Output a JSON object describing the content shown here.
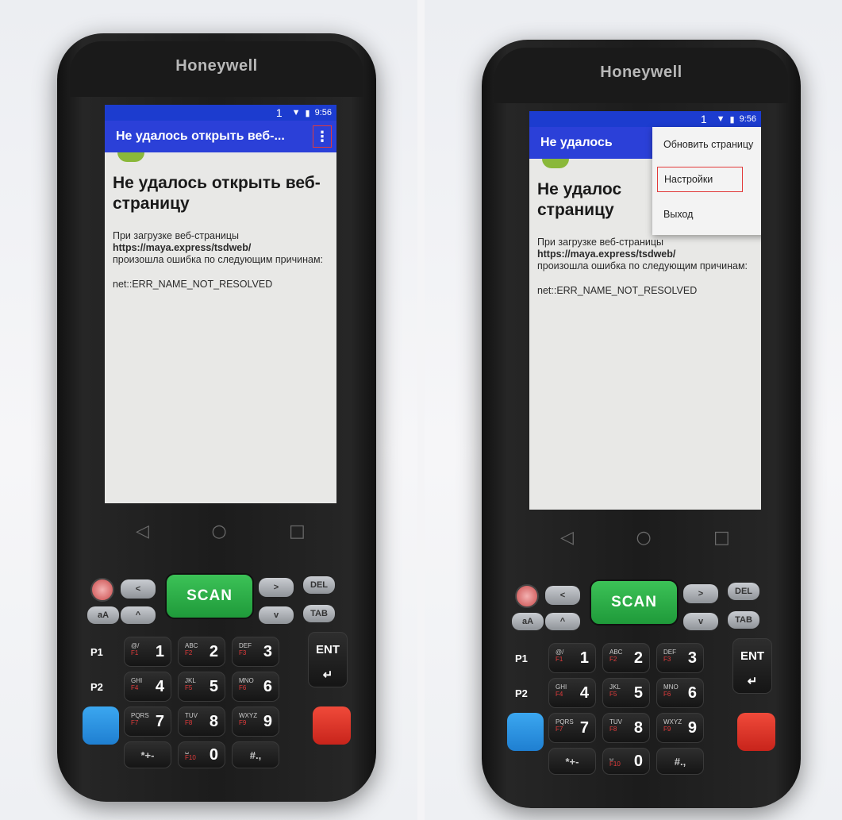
{
  "device": {
    "brand": "Honeywell"
  },
  "status": {
    "sim": "1",
    "time": "9:56"
  },
  "app": {
    "title_truncated": "Не удалось открыть веб-...",
    "title_partial": "Не удалось",
    "overflow_icon": "vertical-dots-icon",
    "heading": "Не удалось открыть веб-страницу",
    "heading_partial_line1": "Не удалос",
    "heading_partial_line2": "страницу",
    "intro": "При загрузке веб-страницы",
    "url": "https://maya.express/tsdweb/",
    "reason": "произошла ошибка по следующим причинам:",
    "error_code": "net::ERR_NAME_NOT_RESOLVED"
  },
  "menu": {
    "items": [
      "Обновить страницу",
      "Настройки",
      "Выход"
    ],
    "highlighted": "Настройки"
  },
  "nav": {
    "back": "◁",
    "home": "○",
    "recents": "□"
  },
  "keys": {
    "scan": "SCAN",
    "del": "DEL",
    "tab": "TAB",
    "ent": "ENT",
    "p1": "P1",
    "p2": "P2",
    "left": "<",
    "right": ">",
    "up": "^",
    "down": "v",
    "shift": "aA",
    "num": [
      {
        "n": "1",
        "sub": "@/",
        "f": "F1"
      },
      {
        "n": "2",
        "sub": "ABC",
        "f": "F2"
      },
      {
        "n": "3",
        "sub": "DEF",
        "f": "F3"
      },
      {
        "n": "4",
        "sub": "GHI",
        "f": "F4"
      },
      {
        "n": "5",
        "sub": "JKL",
        "f": "F5"
      },
      {
        "n": "6",
        "sub": "MNO",
        "f": "F6"
      },
      {
        "n": "7",
        "sub": "PQRS",
        "f": "F7"
      },
      {
        "n": "8",
        "sub": "TUV",
        "f": "F8"
      },
      {
        "n": "9",
        "sub": "WXYZ",
        "f": "F9"
      },
      {
        "n": "0",
        "sub": "␣",
        "f": "F10"
      }
    ],
    "star": "*+-",
    "hash": "#.,"
  },
  "colors": {
    "appbar": "#2b40d8",
    "highlight": "#e23b3b",
    "scan": "#2fb04a"
  }
}
